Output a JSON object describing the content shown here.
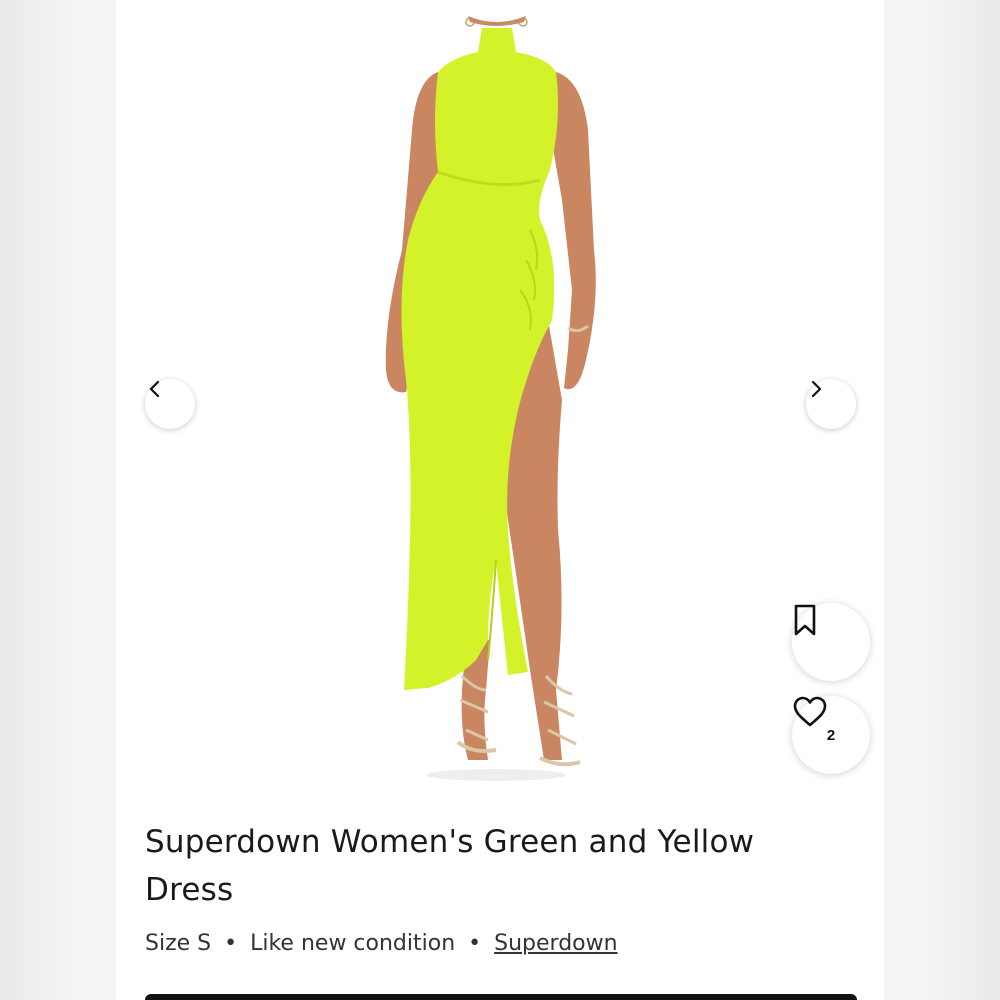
{
  "listing": {
    "title": "Superdown Women's Green and Yellow Dress",
    "size": "Size S",
    "condition": "Like new condition",
    "brand": "Superdown",
    "separator": "•",
    "like_count": "2"
  },
  "icons": {
    "prev": "chevron-left-icon",
    "next": "chevron-right-icon",
    "bookmark": "bookmark-icon",
    "like": "heart-icon"
  },
  "colors": {
    "dress": "#d4f22a",
    "card_background": "#ffffff",
    "page_background": "#f2f2f2",
    "cta": "#111111"
  }
}
